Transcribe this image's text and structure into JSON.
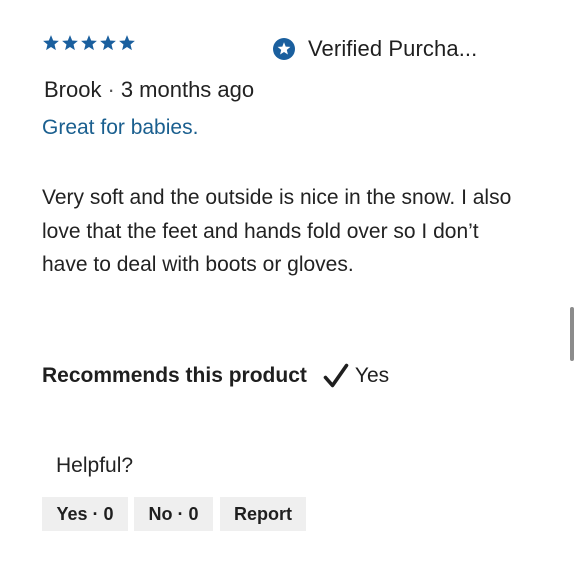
{
  "review": {
    "rating": 5,
    "rating_max": 5,
    "star_color": "#1a5f9e",
    "verified_label": "Verified Purcha...",
    "verified_icon": "verified-star-badge-icon",
    "author": "Brook",
    "separator": "·",
    "posted": "3 months ago",
    "title": "Great for babies.",
    "title_color": "#1a5f8f",
    "body": "Very soft and the outside is nice in the snow. I also love that the feet and hands fold over so I don’t have to deal with boots or gloves.",
    "recommends_label": "Recommends this product",
    "recommends_icon": "checkmark-icon",
    "recommends_value": "Yes"
  },
  "helpful": {
    "label": "Helpful?",
    "yes_label": "Yes · 0",
    "no_label": "No · 0",
    "report_label": "Report"
  }
}
